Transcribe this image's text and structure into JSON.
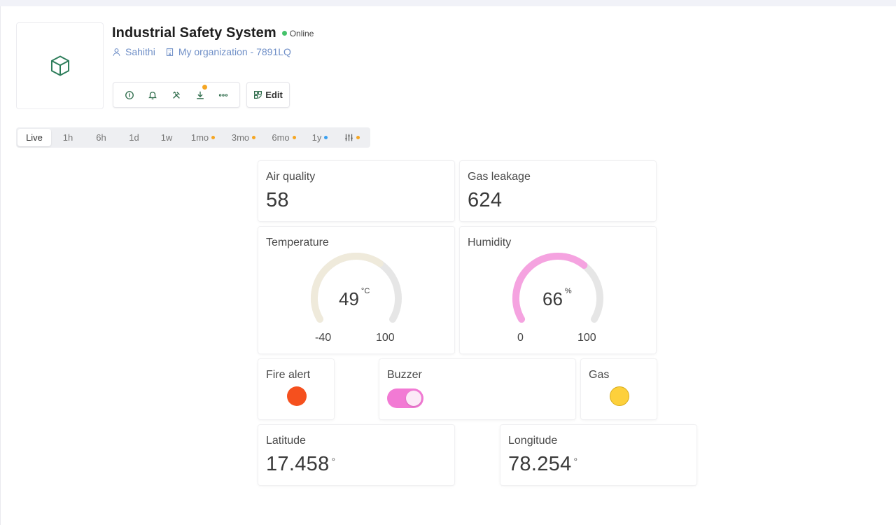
{
  "header": {
    "title": "Industrial Safety System",
    "status": "Online",
    "user": "Sahithi",
    "organization": "My organization - 7891LQ",
    "edit_label": "Edit"
  },
  "toolbar": {
    "icons": [
      "info-icon",
      "bell-icon",
      "tools-icon",
      "download-icon",
      "more-icon"
    ],
    "download_badge_color": "#f5a623"
  },
  "time_ranges": [
    {
      "label": "Live",
      "active": true
    },
    {
      "label": "1h"
    },
    {
      "label": "6h"
    },
    {
      "label": "1d"
    },
    {
      "label": "1w"
    },
    {
      "label": "1mo",
      "dot": "#f5a623"
    },
    {
      "label": "3mo",
      "dot": "#f5a623"
    },
    {
      "label": "6mo",
      "dot": "#f5a623"
    },
    {
      "label": "1y",
      "dot": "#3aa0f0"
    },
    {
      "label": "",
      "icon": "sliders-icon",
      "dot": "#f5a623"
    }
  ],
  "widgets": {
    "air_quality": {
      "label": "Air quality",
      "value": "58"
    },
    "gas_leakage": {
      "label": "Gas leakage",
      "value": "624"
    },
    "temperature": {
      "label": "Temperature",
      "value": "49",
      "unit": "°C",
      "min": "-40",
      "max": "100",
      "level": 0.6429,
      "color": "#efeadb"
    },
    "humidity": {
      "label": "Humidity",
      "value": "66",
      "unit": "%",
      "min": "0",
      "max": "100",
      "level": 0.66,
      "color": "#f5a3e0"
    },
    "fire_alert": {
      "label": "Fire alert",
      "color": "#f5501e"
    },
    "buzzer": {
      "label": "Buzzer",
      "on": true,
      "color": "#f27ad4"
    },
    "gas": {
      "label": "Gas",
      "color": "#fdd03b"
    },
    "latitude": {
      "label": "Latitude",
      "value": "17.458",
      "unit": "°"
    },
    "longitude": {
      "label": "Longitude",
      "value": "78.254",
      "unit": "°"
    }
  }
}
